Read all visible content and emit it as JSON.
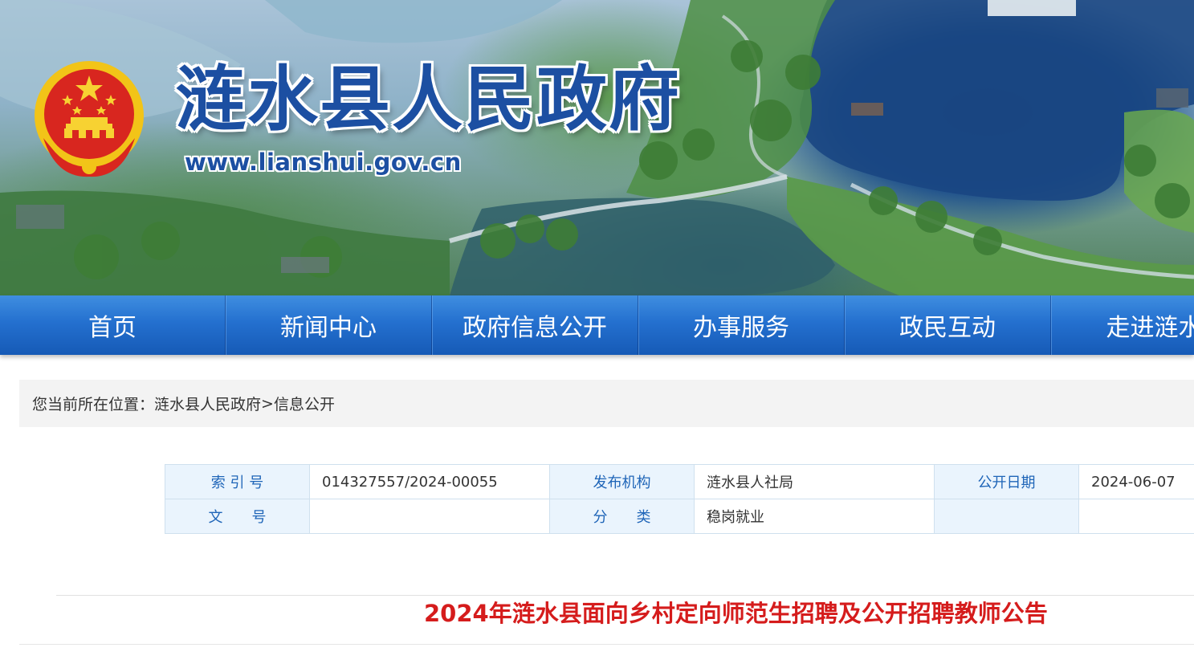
{
  "banner": {
    "site_title": "涟水县人民政府",
    "site_url": "www.lianshui.gov.cn"
  },
  "nav": {
    "items": [
      {
        "label": "首页"
      },
      {
        "label": "新闻中心"
      },
      {
        "label": "政府信息公开"
      },
      {
        "label": "办事服务"
      },
      {
        "label": "政民互动"
      },
      {
        "label": "走进涟水"
      }
    ]
  },
  "breadcrumb": {
    "prefix": "您当前所在位置：",
    "home": "涟水县人民政府",
    "separator": ">",
    "current": "信息公开"
  },
  "meta": {
    "index_label": "索 引 号",
    "index_value": "014327557/2024-00055",
    "publisher_label": "发布机构",
    "publisher_value": "涟水县人社局",
    "date_label": "公开日期",
    "date_value": "2024-06-07",
    "docno_label": "文　　号",
    "docno_value": "",
    "category_label": "分　　类",
    "category_value": "稳岗就业",
    "extra_label": "",
    "extra_value": ""
  },
  "article": {
    "title": "2024年涟水县面向乡村定向师范生招聘及公开招聘教师公告"
  },
  "colors": {
    "nav_blue": "#2470cf",
    "title_red": "#d51c1c",
    "label_blue": "#1f65b8",
    "brand_blue": "#1c4fa2",
    "emblem_red": "#d8261f",
    "emblem_gold": "#f2c418"
  },
  "icons": {
    "emblem": "national-emblem-icon"
  }
}
